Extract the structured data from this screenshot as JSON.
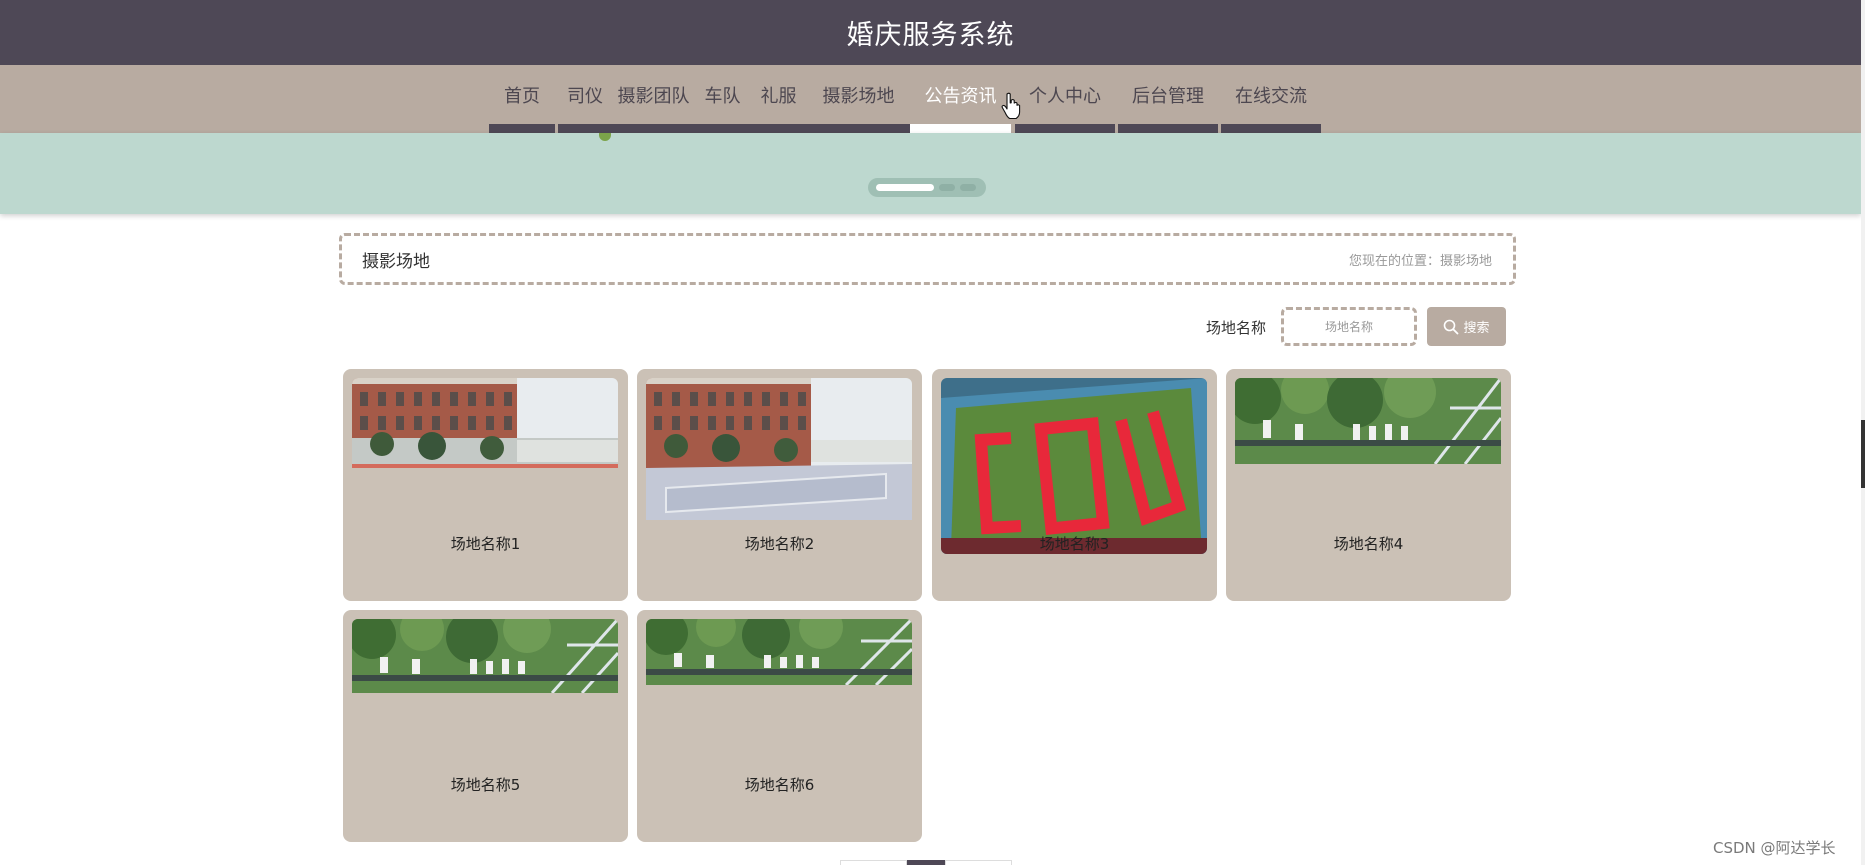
{
  "header": {
    "title": "婚庆服务系统"
  },
  "nav": {
    "items": [
      {
        "label": "首页"
      },
      {
        "label": "司仪"
      },
      {
        "label": "摄影团队"
      },
      {
        "label": "车队"
      },
      {
        "label": "礼服"
      },
      {
        "label": "摄影场地"
      },
      {
        "label": "公告资讯",
        "active": true
      },
      {
        "label": "个人中心"
      },
      {
        "label": "后台管理"
      },
      {
        "label": "在线交流"
      }
    ]
  },
  "carousel": {
    "slide_count": 3,
    "active_index": 0
  },
  "breadcrumb": {
    "title": "摄影场地",
    "location_text": "您现在的位置：摄影场地"
  },
  "search": {
    "label": "场地名称",
    "placeholder": "场地名称",
    "value": "",
    "button_label": "搜索"
  },
  "venues": [
    {
      "name": "场地名称1",
      "photo": "brick-building"
    },
    {
      "name": "场地名称2",
      "photo": "brick-building-plaza"
    },
    {
      "name": "场地名称3",
      "photo": "stadium-aerial"
    },
    {
      "name": "场地名称4",
      "photo": "group-trees"
    },
    {
      "name": "场地名称5",
      "photo": "group-trees"
    },
    {
      "name": "场地名称6",
      "photo": "group-trees"
    }
  ],
  "watermark": "CSDN @阿达学长",
  "colors": {
    "header_bg": "#4e4856",
    "nav_bg": "#b8aba1",
    "banner_bg": "#bdd8cf",
    "card_bg": "#cbc1b6"
  }
}
